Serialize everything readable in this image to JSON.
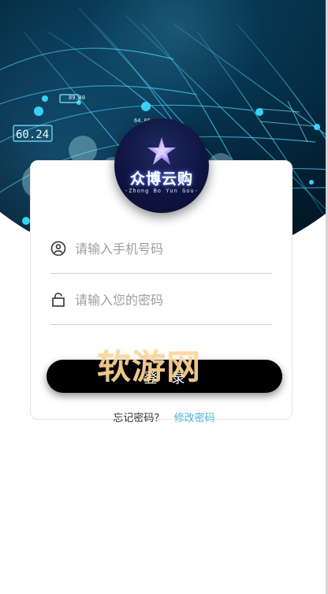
{
  "brand": {
    "title": "众博云购",
    "subtitle": "-Zhong Bo Yun Gou-"
  },
  "hero": {
    "badge_text": "60.24",
    "small_label_1": "89.40",
    "small_label_2": "64.06"
  },
  "form": {
    "phone_placeholder": "请输入手机号码",
    "password_placeholder": "请输入您的密码",
    "login_label": "登录"
  },
  "footer": {
    "forgot_text": "忘记密码？",
    "modify_link": "修改密码"
  },
  "watermark": {
    "text": "软游网"
  },
  "icons": {
    "user": "user-icon",
    "lock": "lock-icon",
    "logo": "star-logo-icon"
  },
  "colors": {
    "accent": "#4db2d7",
    "button_bg": "#000000",
    "hero_bg": "#031b2b",
    "watermark": "#ffd696"
  }
}
